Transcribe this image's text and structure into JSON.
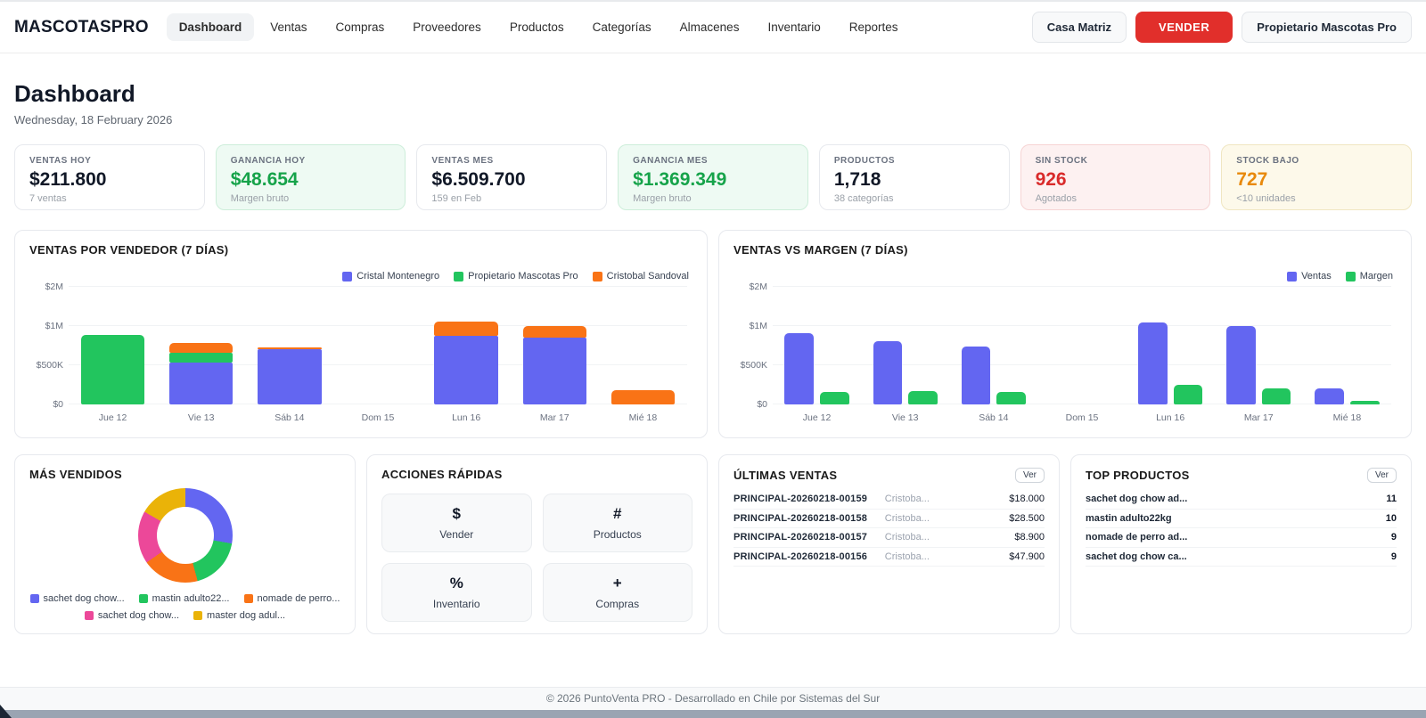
{
  "brand": "MASCOTASPRO",
  "nav": {
    "items": [
      "Dashboard",
      "Ventas",
      "Compras",
      "Proveedores",
      "Productos",
      "Categorías",
      "Almacenes",
      "Inventario",
      "Reportes"
    ],
    "active": "Dashboard"
  },
  "header_actions": {
    "branch_label": "Casa Matriz",
    "vender_label": "VENDER",
    "user_label": "Propietario Mascotas Pro"
  },
  "page": {
    "title": "Dashboard",
    "date": "Wednesday, 18 February 2026"
  },
  "kpis": [
    {
      "label": "VENTAS HOY",
      "value": "$211.800",
      "sub": "7 ventas",
      "variant": "default"
    },
    {
      "label": "GANANCIA HOY",
      "value": "$48.654",
      "sub": "Margen bruto",
      "variant": "green"
    },
    {
      "label": "VENTAS MES",
      "value": "$6.509.700",
      "sub": "159 en Feb",
      "variant": "default"
    },
    {
      "label": "GANANCIA MES",
      "value": "$1.369.349",
      "sub": "Margen bruto",
      "variant": "green"
    },
    {
      "label": "PRODUCTOS",
      "value": "1,718",
      "sub": "38 categorías",
      "variant": "default"
    },
    {
      "label": "SIN STOCK",
      "value": "926",
      "sub": "Agotados",
      "variant": "red"
    },
    {
      "label": "STOCK BAJO",
      "value": "727",
      "sub": "<10 unidades",
      "variant": "amber"
    }
  ],
  "chart_data": [
    {
      "type": "bar",
      "variant": "stacked",
      "title": "VENTAS POR VENDEDOR (7 DÍAS)",
      "categories": [
        "Jue 12",
        "Vie 13",
        "Sáb 14",
        "Dom 15",
        "Lun 16",
        "Mar 17",
        "Mié 18"
      ],
      "series": [
        {
          "name": "Cristal Montenegro",
          "color": "#6366f1",
          "values": [
            0,
            530000,
            700000,
            0,
            880000,
            850000,
            0
          ]
        },
        {
          "name": "Propietario Mascotas Pro",
          "color": "#22c55e",
          "values": [
            890000,
            130000,
            0,
            0,
            0,
            0,
            0
          ]
        },
        {
          "name": "Cristobal Sandoval",
          "color": "#f97316",
          "values": [
            0,
            120000,
            30000,
            0,
            240000,
            160000,
            185000
          ]
        }
      ],
      "yticks": {
        "values": [
          0,
          500000,
          1000000,
          2000000
        ],
        "labels": [
          "$0",
          "$500K",
          "$1M",
          "$2M"
        ]
      },
      "ylim": [
        0,
        2000000
      ],
      "legend_position": "top-right",
      "grid": true
    },
    {
      "type": "bar",
      "variant": "grouped",
      "title": "VENTAS VS MARGEN (7 DÍAS)",
      "categories": [
        "Jue 12",
        "Vie 13",
        "Sáb 14",
        "Dom 15",
        "Lun 16",
        "Mar 17",
        "Mié 18"
      ],
      "series": [
        {
          "name": "Ventas",
          "color": "#6366f1",
          "values": [
            910000,
            810000,
            740000,
            0,
            1100000,
            1010000,
            210000
          ]
        },
        {
          "name": "Margen",
          "color": "#22c55e",
          "values": [
            160000,
            165000,
            155000,
            0,
            250000,
            205000,
            45000
          ]
        }
      ],
      "yticks": {
        "values": [
          0,
          500000,
          1000000,
          2000000
        ],
        "labels": [
          "$0",
          "$500K",
          "$1M",
          "$2M"
        ]
      },
      "ylim": [
        0,
        2000000
      ],
      "legend_position": "top-right",
      "grid": true
    },
    {
      "type": "pie",
      "variant": "donut",
      "title": "MÁS VENDIDOS",
      "segments": [
        {
          "label": "sachet dog chow...",
          "color": "#6366f1",
          "deg": 100
        },
        {
          "label": "mastin adulto22...",
          "color": "#22c55e",
          "deg": 65
        },
        {
          "label": "nomade de perro...",
          "color": "#f97316",
          "deg": 70
        },
        {
          "label": "sachet dog chow...",
          "color": "#ec4899",
          "deg": 65
        },
        {
          "label": "master dog adul...",
          "color": "#eab308",
          "deg": 60
        }
      ]
    }
  ],
  "quick_actions": {
    "title": "ACCIONES RÁPIDAS",
    "items": [
      {
        "icon": "$",
        "label": "Vender"
      },
      {
        "icon": "#",
        "label": "Productos"
      },
      {
        "icon": "%",
        "label": "Inventario"
      },
      {
        "icon": "+",
        "label": "Compras"
      }
    ]
  },
  "last_sales": {
    "title": "ÚLTIMAS VENTAS",
    "ver_label": "Ver",
    "rows": [
      {
        "code": "PRINCIPAL-20260218-00159",
        "seller": "Cristoba...",
        "amount": "$18.000"
      },
      {
        "code": "PRINCIPAL-20260218-00158",
        "seller": "Cristoba...",
        "amount": "$28.500"
      },
      {
        "code": "PRINCIPAL-20260218-00157",
        "seller": "Cristoba...",
        "amount": "$8.900"
      },
      {
        "code": "PRINCIPAL-20260218-00156",
        "seller": "Cristoba...",
        "amount": "$47.900"
      }
    ]
  },
  "top_products": {
    "title": "TOP PRODUCTOS",
    "ver_label": "Ver",
    "rows": [
      {
        "name": "sachet dog chow ad...",
        "qty": "11"
      },
      {
        "name": "mastin adulto22kg",
        "qty": "10"
      },
      {
        "name": "nomade de perro ad...",
        "qty": "9"
      },
      {
        "name": "sachet dog chow ca...",
        "qty": "9"
      }
    ]
  },
  "footer": {
    "text": "© 2026 PuntoVenta PRO - Desarrollado en Chile por Sistemas del Sur"
  },
  "colors": {
    "accent_red": "#e12f2b",
    "green_text": "#16a34a",
    "red_text": "#d92b2b",
    "amber_text": "#e8890c",
    "chart_blue": "#6366f1",
    "chart_green": "#22c55e",
    "chart_orange": "#f97316",
    "chart_pink": "#ec4899",
    "chart_yellow": "#eab308"
  }
}
